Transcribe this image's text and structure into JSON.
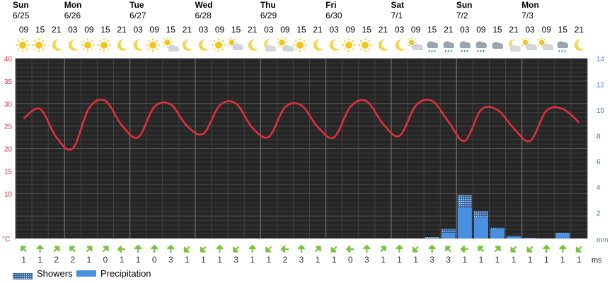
{
  "days": [
    {
      "weekday": "Sun",
      "date": "6/25"
    },
    {
      "weekday": "Mon",
      "date": "6/26"
    },
    {
      "weekday": "Tue",
      "date": "6/27"
    },
    {
      "weekday": "Wed",
      "date": "6/28"
    },
    {
      "weekday": "Thu",
      "date": "6/29"
    },
    {
      "weekday": "Fri",
      "date": "6/30"
    },
    {
      "weekday": "Sat",
      "date": "7/1"
    },
    {
      "weekday": "Sun",
      "date": "7/2"
    },
    {
      "weekday": "Mon",
      "date": "7/3"
    }
  ],
  "hours": [
    "09",
    "15",
    "21",
    "03",
    "09",
    "15",
    "21",
    "03",
    "09",
    "15",
    "21",
    "03",
    "09",
    "15",
    "21",
    "03",
    "09",
    "15",
    "21",
    "03",
    "09",
    "15",
    "21",
    "03",
    "09",
    "15",
    "21",
    "03",
    "09",
    "15",
    "21",
    "03",
    "09",
    "15",
    "21"
  ],
  "icons": [
    "sun",
    "sun",
    "moon",
    "moon",
    "sun",
    "sun",
    "moon",
    "moon",
    "sun",
    "sun-cloud",
    "moon",
    "moon",
    "sun",
    "cloud-sun",
    "moon",
    "moon-cloud",
    "sun-cloud",
    "sun",
    "moon",
    "moon",
    "sun",
    "sun",
    "moon",
    "moon",
    "cloud-sun",
    "cloud-rain",
    "cloud-rain",
    "cloud-rain",
    "cloud-rain",
    "cloud",
    "moon-cloud",
    "cloud-sun",
    "cloud-sun",
    "cloud-rain",
    "moon"
  ],
  "colors": {
    "background": "#262626",
    "temperature_line": "#e0303a",
    "precipitation": "#4a90e2",
    "showers": "#8ec4f0",
    "left_axis": "#d83030",
    "right_axis": "#3a7fd5",
    "wind_arrow": "#7dc242",
    "sun": "#f5c518",
    "moon": "#f2d64b",
    "cloud": "#9aa4ad"
  },
  "chart_data": {
    "type": "line",
    "x": [
      "09",
      "15",
      "21",
      "03",
      "09",
      "15",
      "21",
      "03",
      "09",
      "15",
      "21",
      "03",
      "09",
      "15",
      "21",
      "03",
      "09",
      "15",
      "21",
      "03",
      "09",
      "15",
      "21",
      "03",
      "09",
      "15",
      "21",
      "03",
      "09",
      "15",
      "21",
      "03",
      "09",
      "15",
      "21"
    ],
    "series": [
      {
        "name": "",
        "axis": "left",
        "values": [
          26.7,
          28.8,
          22.5,
          20.0,
          29.0,
          30.6,
          25.2,
          22.5,
          29.3,
          29.8,
          25.0,
          23.3,
          29.6,
          30.0,
          24.6,
          22.6,
          29.2,
          29.6,
          24.8,
          22.5,
          29.3,
          30.5,
          25.5,
          22.8,
          29.5,
          30.6,
          26.0,
          21.7,
          28.6,
          28.6,
          24.5,
          21.7,
          28.4,
          28.8,
          25.8
        ]
      },
      {
        "name": "Precipitation",
        "type": "bar",
        "axis": "right",
        "values": [
          0,
          0,
          0,
          0,
          0,
          0,
          0,
          0,
          0,
          0,
          0,
          0,
          0,
          0,
          0,
          0,
          0,
          0,
          0,
          0,
          0,
          0,
          0,
          0,
          0,
          0.05,
          0.45,
          2.4,
          1.65,
          0.7,
          0.12,
          0.02,
          0,
          0.4,
          0
        ]
      },
      {
        "name": "Showers",
        "type": "bar",
        "axis": "right",
        "values": [
          0,
          0,
          0,
          0,
          0,
          0,
          0,
          0,
          0,
          0,
          0,
          0,
          0,
          0,
          0,
          0,
          0,
          0,
          0,
          0,
          0,
          0,
          0,
          0,
          0,
          0.05,
          0.3,
          1.0,
          0.5,
          0.15,
          0.1,
          0.04,
          0,
          0.05,
          0
        ]
      }
    ],
    "y_left": {
      "ylim": [
        0,
        40
      ],
      "ticks": [
        "40",
        "35",
        "30",
        "25",
        "20",
        "15",
        "10"
      ],
      "unit": "°C"
    },
    "y_right": {
      "ylim": [
        0,
        14
      ],
      "ticks": [
        "14",
        "12",
        "10",
        "8",
        "6",
        "4",
        "2"
      ],
      "unit": "mm"
    },
    "grid": true,
    "wind": {
      "unit": "ms",
      "speeds": [
        "1",
        "1",
        "2",
        "2",
        "1",
        "0",
        "1",
        "1",
        "0",
        "3",
        "1",
        "1",
        "1",
        "3",
        "1",
        "1",
        "2",
        "3",
        "1",
        "1",
        "0",
        "3",
        "1",
        "1",
        "1",
        "3",
        "3",
        "1",
        "1",
        "1",
        "1",
        "1",
        "1",
        "1",
        "1"
      ],
      "directions": [
        315,
        0,
        45,
        315,
        45,
        45,
        270,
        0,
        0,
        0,
        225,
        225,
        0,
        225,
        0,
        225,
        270,
        0,
        45,
        225,
        270,
        0,
        45,
        0,
        225,
        0,
        315,
        270,
        315,
        45,
        225,
        225,
        0,
        0,
        225
      ]
    },
    "legend": [
      "Showers",
      "Precipitation"
    ],
    "legend_position": "bottom-left"
  }
}
